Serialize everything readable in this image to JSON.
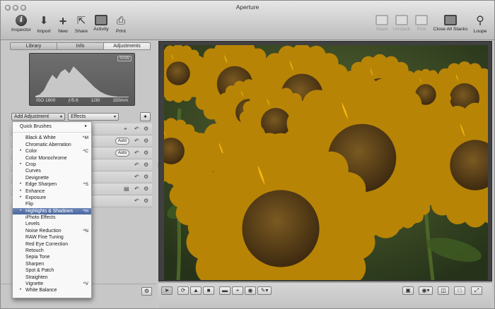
{
  "window": {
    "title": "Aperture"
  },
  "toolbar": {
    "left": [
      {
        "label": "Inspector",
        "icon": "info-icon"
      },
      {
        "label": "Import",
        "icon": "import-arrow-icon"
      },
      {
        "label": "New",
        "icon": "plus-icon"
      },
      {
        "label": "Share",
        "icon": "share-icon"
      },
      {
        "label": "Activity",
        "icon": "activity-icon"
      },
      {
        "label": "Print",
        "icon": "printer-icon"
      }
    ],
    "right": [
      {
        "label": "Stack",
        "icon": "stack-icon",
        "enabled": false
      },
      {
        "label": "Unstack",
        "icon": "unstack-icon",
        "enabled": false
      },
      {
        "label": "Pick",
        "icon": "pick-icon",
        "enabled": false
      },
      {
        "label": "Close All Stacks",
        "icon": "close-stacks-icon",
        "enabled": true
      },
      {
        "label": "Loupe",
        "icon": "loupe-icon",
        "enabled": true
      }
    ]
  },
  "inspector": {
    "tabs": [
      "Library",
      "Info",
      "Adjustments"
    ],
    "active_tab": "Adjustments",
    "histogram": {
      "badge": "RAW",
      "exif": [
        "ISO 1600",
        "ƒ/5.6",
        "1/30",
        "150mm"
      ]
    },
    "add_adjustment_label": "Add Adjustment",
    "effects_label": "Effects",
    "auto_label": "Auto"
  },
  "menu": {
    "items": [
      {
        "label": "Quick Brushes",
        "submenu": true
      },
      {
        "label": "Black & White",
        "shortcut": "^M"
      },
      {
        "label": "Chromatic Aberration"
      },
      {
        "label": "Color",
        "dot": true,
        "shortcut": "^C"
      },
      {
        "label": "Color Monochrome"
      },
      {
        "label": "Crop",
        "dot": true
      },
      {
        "label": "Curves"
      },
      {
        "label": "Devignette"
      },
      {
        "label": "Edge Sharpen",
        "dot": true,
        "shortcut": "^S"
      },
      {
        "label": "Enhance",
        "dot": true
      },
      {
        "label": "Exposure",
        "dot": true
      },
      {
        "label": "Flip"
      },
      {
        "label": "Highlights & Shadows",
        "dot": true,
        "shortcut": "^H",
        "highlighted": true
      },
      {
        "label": "iPhoto Effects"
      },
      {
        "label": "Levels"
      },
      {
        "label": "Noise Reduction",
        "shortcut": "^N"
      },
      {
        "label": "RAW Fine Tuning"
      },
      {
        "label": "Red Eye Correction"
      },
      {
        "label": "Retouch"
      },
      {
        "label": "Sepia Tone"
      },
      {
        "label": "Sharpen"
      },
      {
        "label": "Spot & Patch"
      },
      {
        "label": "Straighten"
      },
      {
        "label": "Vignette",
        "shortcut": "^V"
      },
      {
        "label": "White Balance",
        "dot": true
      }
    ]
  },
  "viewer": {
    "image": "sunflower-field-photo"
  },
  "colors": {
    "menu_highlight": "#4a66a0",
    "viewer_bg": "#404040"
  }
}
